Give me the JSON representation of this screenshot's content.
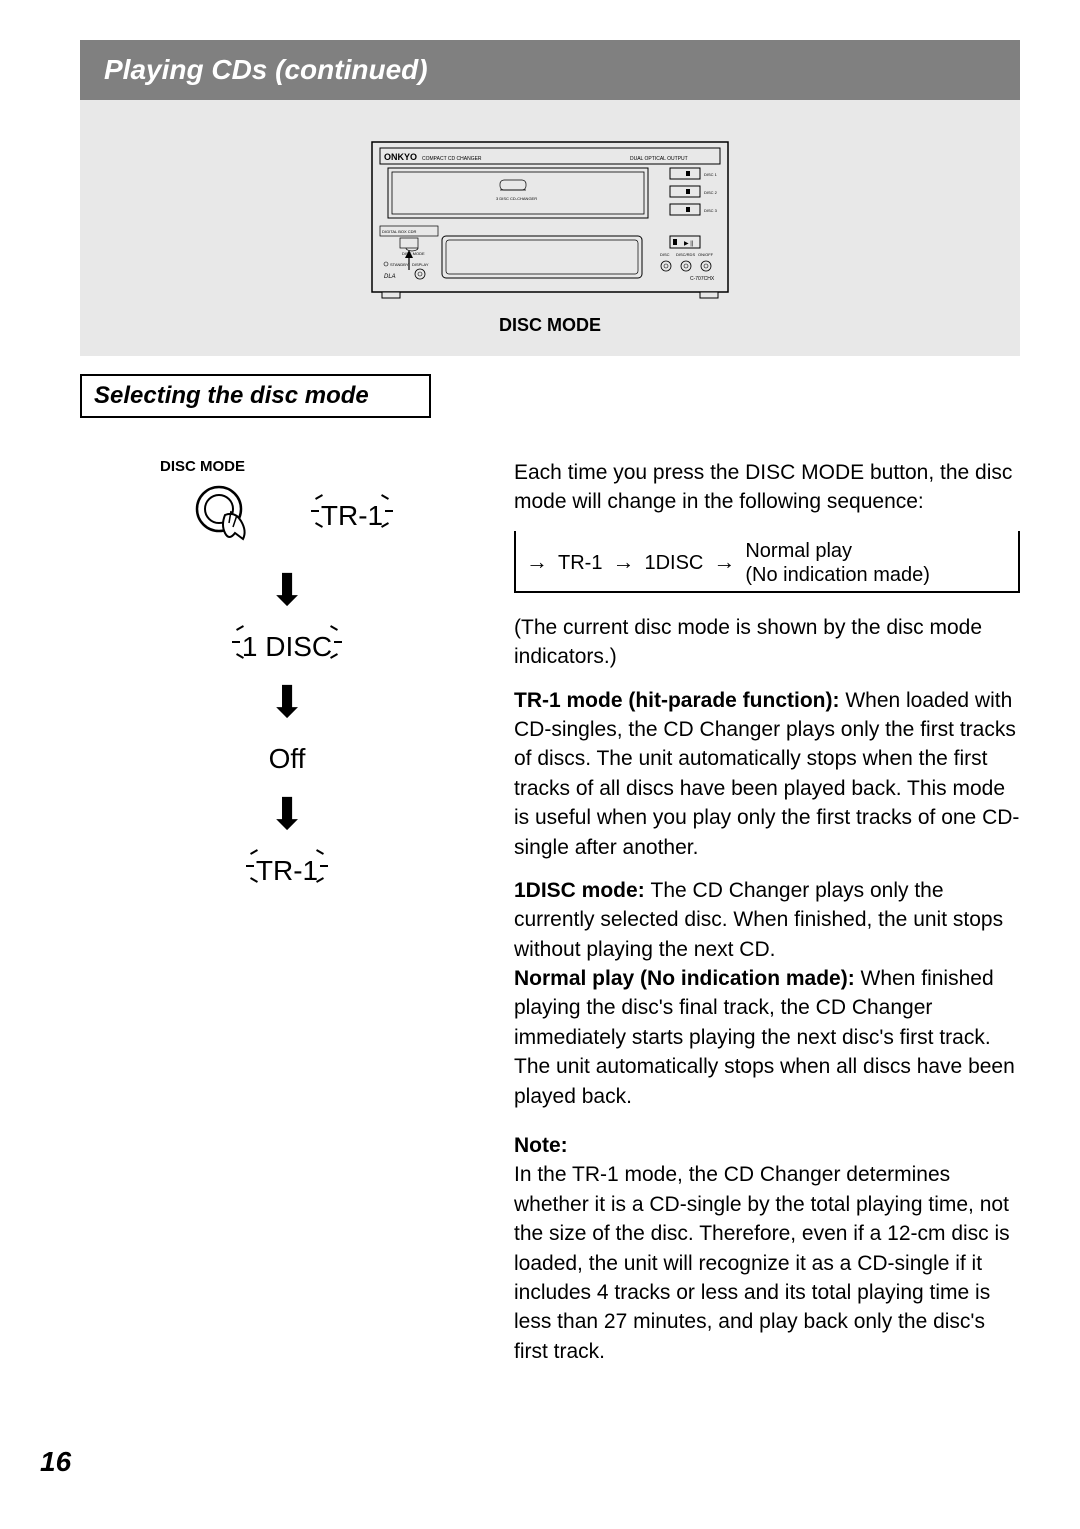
{
  "header": {
    "title": "Playing CDs (continued)"
  },
  "device": {
    "brand": "ONKYO",
    "brand_sub": "COMPACT CD CHANGER",
    "dual_out": "DUAL OPTICAL OUTPUT",
    "tray_sub": "3 DISC CD-CHANGER",
    "disc1": "DISC 1",
    "disc2": "DISC 2",
    "disc3": "DISC 3",
    "label": "DISC MODE"
  },
  "section_title": "Selecting the disc mode",
  "left": {
    "small_label": "DISC MODE",
    "step1": "TR-1",
    "step2": "1 DISC",
    "step3": "Off",
    "step4": "TR-1"
  },
  "right": {
    "intro": "Each time you press the DISC MODE button, the disc mode will change in the following sequence:",
    "flow": {
      "a": "TR-1",
      "b": "1DISC",
      "c1": "Normal play",
      "c2": "(No indication made)"
    },
    "paren": "(The current disc mode is shown by the disc mode indicators.)",
    "tr1_label": "TR-1 mode (hit-parade function): ",
    "tr1_body": "When loaded with CD-singles, the CD Changer plays only the first tracks of discs. The unit automatically stops when the first tracks of all discs have been played back. This mode is useful when you play only the first tracks of one CD-single after another.",
    "onedisc_label": "1DISC mode: ",
    "onedisc_body": "The CD Changer plays only the currently selected disc. When finished, the unit stops without playing the next CD.",
    "normal_label": "Normal play (No indication made): ",
    "normal_body": "When finished playing the disc's final track, the CD Changer immediately starts playing the next disc's first track. The unit automatically stops when all discs have been played back.",
    "note_label": "Note:",
    "note_body": "In the TR-1 mode, the CD Changer determines whether it is a CD-single by the total playing time, not the size of the disc. Therefore, even if a 12-cm disc is loaded, the unit will recognize it as a CD-single if it includes 4 tracks or less and its total playing time is less than 27 minutes, and play back only the disc's first track."
  },
  "page_number": "16"
}
